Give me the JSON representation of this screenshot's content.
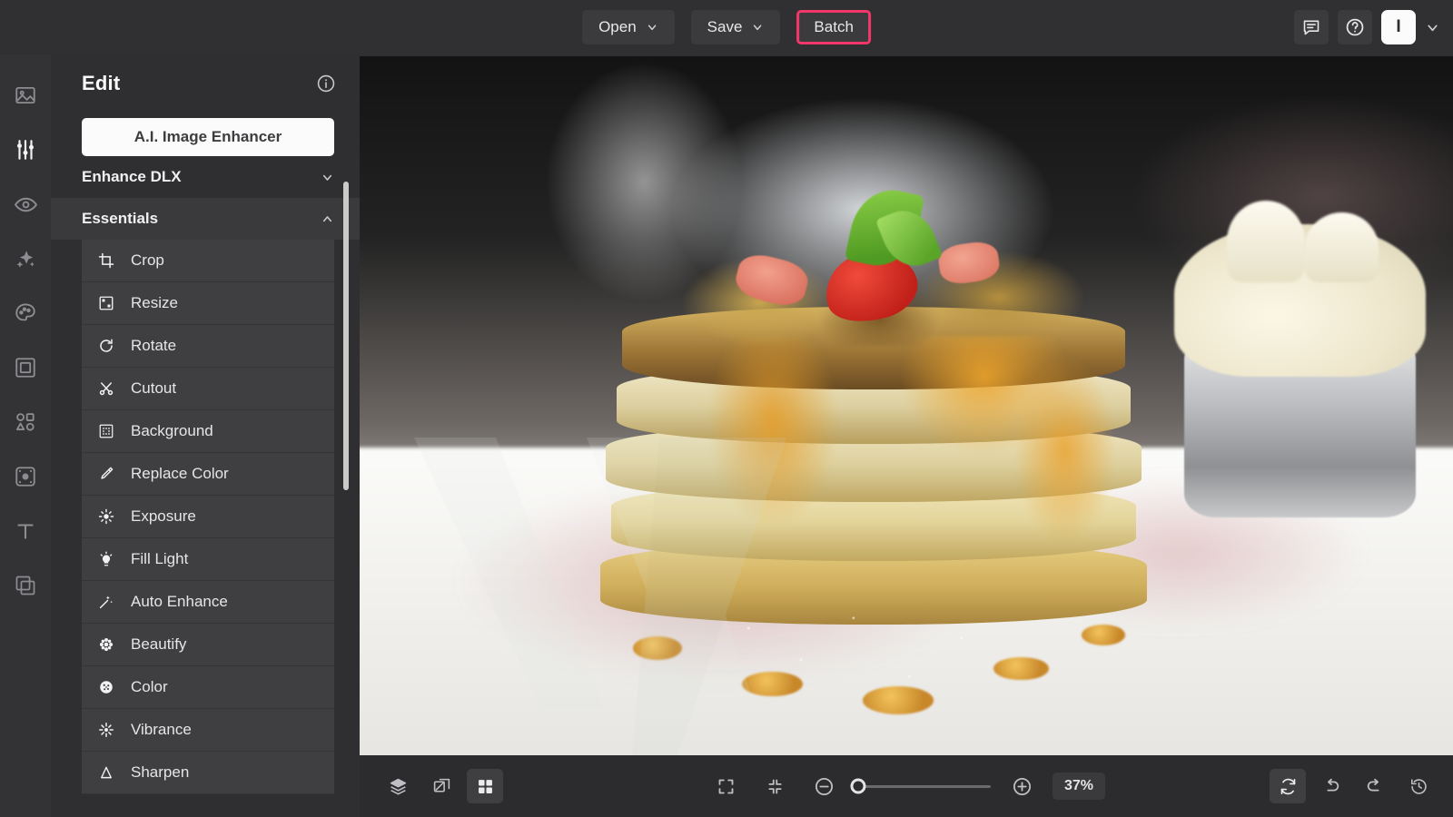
{
  "topbar": {
    "open_label": "Open",
    "save_label": "Save",
    "batch_label": "Batch",
    "feedback_icon": "chat-icon",
    "help_icon": "help-icon",
    "avatar_initial": "I",
    "avatar_chevron_icon": "chevron-down-icon",
    "highlight_color": "#f5366b"
  },
  "rail": {
    "items": [
      {
        "icon": "image-icon",
        "active": false
      },
      {
        "icon": "sliders-icon",
        "active": true
      },
      {
        "icon": "eye-icon",
        "active": false
      },
      {
        "icon": "sparkle-icon",
        "active": false
      },
      {
        "icon": "palette-icon",
        "active": false
      },
      {
        "icon": "frame-icon",
        "active": false
      },
      {
        "icon": "shapes-icon",
        "active": false
      },
      {
        "icon": "texture-icon",
        "active": false
      },
      {
        "icon": "text-icon",
        "active": false
      },
      {
        "icon": "overlay-icon",
        "active": false
      }
    ]
  },
  "panel": {
    "title": "Edit",
    "info_icon": "info-icon",
    "ai_button_label": "A.I. Image Enhancer",
    "sections": [
      {
        "label": "Enhance DLX",
        "expanded": false,
        "chevron": "chevron-down-icon"
      },
      {
        "label": "Essentials",
        "expanded": true,
        "chevron": "chevron-up-icon"
      }
    ],
    "tools": [
      {
        "label": "Crop",
        "icon": "crop-icon"
      },
      {
        "label": "Resize",
        "icon": "resize-icon"
      },
      {
        "label": "Rotate",
        "icon": "rotate-icon"
      },
      {
        "label": "Cutout",
        "icon": "scissors-icon"
      },
      {
        "label": "Background",
        "icon": "checker-icon"
      },
      {
        "label": "Replace Color",
        "icon": "brush-icon"
      },
      {
        "label": "Exposure",
        "icon": "sun-icon"
      },
      {
        "label": "Fill Light",
        "icon": "bulb-icon"
      },
      {
        "label": "Auto Enhance",
        "icon": "wand-icon"
      },
      {
        "label": "Beautify",
        "icon": "flower-icon"
      },
      {
        "label": "Color",
        "icon": "color-wheel-icon"
      },
      {
        "label": "Vibrance",
        "icon": "star-burst-icon"
      },
      {
        "label": "Sharpen",
        "icon": "triangle-icon"
      }
    ]
  },
  "canvas": {
    "subject": "stack of pancakes with strawberry, mint and caramel syrup on a white plate with a metal ramekin of whipped cream",
    "watermark": "IVA"
  },
  "bottombar": {
    "left_icons": [
      {
        "icon": "layers-icon",
        "active": false
      },
      {
        "icon": "compare-icon",
        "active": false
      },
      {
        "icon": "grid-icon",
        "active": true
      }
    ],
    "fit_icon": "fit-screen-icon",
    "fill_icon": "fill-screen-icon",
    "zoom_out_icon": "zoom-out-icon",
    "zoom_in_icon": "zoom-in-icon",
    "zoom_value": "37%",
    "right_icons": [
      {
        "icon": "reset-icon",
        "active": true
      },
      {
        "icon": "undo-icon",
        "active": false
      },
      {
        "icon": "redo-icon",
        "active": false
      },
      {
        "icon": "history-icon",
        "active": false
      }
    ]
  }
}
